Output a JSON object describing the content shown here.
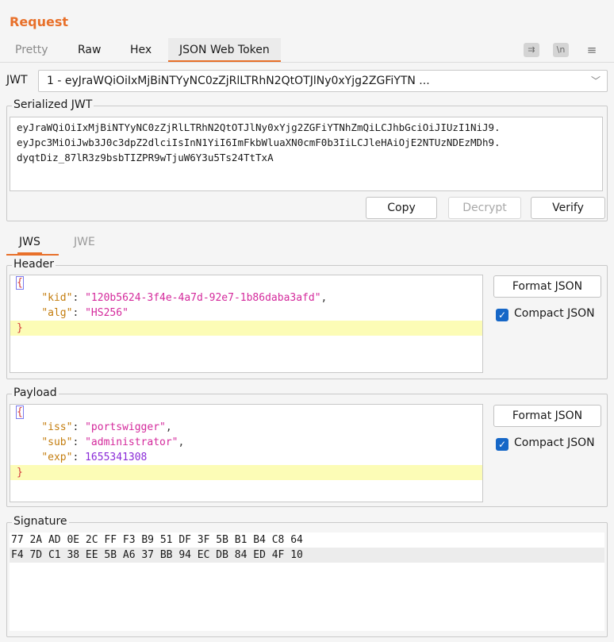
{
  "panel_title": "Request",
  "tabs": [
    {
      "label": "Pretty",
      "active": false
    },
    {
      "label": "Raw",
      "active": false
    },
    {
      "label": "Hex",
      "active": false
    },
    {
      "label": "JSON Web Token",
      "active": true
    }
  ],
  "toolbar_icons": [
    "wrap-icon",
    "newline-icon",
    "menu-icon"
  ],
  "toolbar_icon_glyphs": [
    "⇉",
    "\\n",
    "≡"
  ],
  "jwt": {
    "label": "JWT",
    "selected": "1 - eyJraWQiOiIxMjBiNTYyNC0zZjRlLTRhN2QtOTJlNy0xYjg2ZGFiYTN ...",
    "chevron": "﹀"
  },
  "serialized": {
    "legend": "Serialized JWT",
    "lines": [
      "eyJraWQiOiIxMjBiNTYyNC0zZjRlLTRhN2QtOTJlNy0xYjg2ZGFiYTNhZmQiLCJhbGciOiJIUzI1NiJ9.",
      "eyJpc3MiOiJwb3J0c3dpZ2dlciIsInN1YiI6ImFkbWluaXN0cmF0b3IiLCJleHAiOjE2NTUzNDEzMDh9.",
      "dyqtDiz_87lR3z9bsbTIZPR9wTjuW6Y3u5Ts24TtTxA"
    ],
    "buttons": {
      "copy": "Copy",
      "decrypt": "Decrypt",
      "verify": "Verify"
    }
  },
  "subtabs": [
    {
      "label": "JWS",
      "active": true
    },
    {
      "label": "JWE",
      "active": false
    }
  ],
  "header": {
    "legend": "Header",
    "open_brace": "{",
    "close_brace": "}",
    "fields": [
      {
        "key": "\"kid\"",
        "sep": ": ",
        "value": "\"120b5624-3f4e-4a7d-92e7-1b86daba3afd\"",
        "trail": ","
      },
      {
        "key": "\"alg\"",
        "sep": ": ",
        "value": "\"HS256\"",
        "trail": ""
      }
    ],
    "format_button": "Format JSON",
    "compact_label": "Compact JSON",
    "compact_checked": true,
    "check_glyph": "✓"
  },
  "payload": {
    "legend": "Payload",
    "open_brace": "{",
    "close_brace": "}",
    "fields": [
      {
        "key": "\"iss\"",
        "sep": ": ",
        "value": "\"portswigger\"",
        "trail": ","
      },
      {
        "key": "\"sub\"",
        "sep": ": ",
        "value": "\"administrator\"",
        "trail": ","
      },
      {
        "key": "\"exp\"",
        "sep": ": ",
        "value": "1655341308",
        "trail": ""
      }
    ],
    "format_button": "Format JSON",
    "compact_label": "Compact JSON",
    "compact_checked": true,
    "check_glyph": "✓"
  },
  "signature": {
    "legend": "Signature",
    "lines": [
      "77 2A AD 0E 2C FF F3 B9 51 DF 3F 5B B1 B4 C8 64",
      "F4 7D C1 38 EE 5B A6 37 BB 94 EC DB 84 ED 4F 10"
    ]
  }
}
